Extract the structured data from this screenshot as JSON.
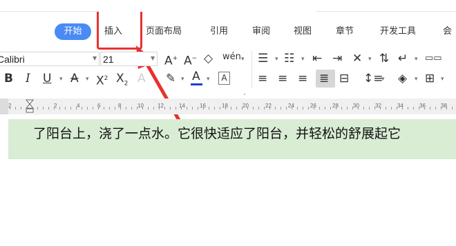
{
  "tabs": {
    "start": "开始",
    "insert": "插入",
    "layout": "页面布局",
    "references": "引用",
    "review": "审阅",
    "view": "视图",
    "section": "章节",
    "developer": "开发工具",
    "more": "会"
  },
  "font": {
    "name": "Calibri",
    "size": "21"
  },
  "ruler_numbers": [
    "2",
    "2",
    "4",
    "6",
    "8",
    "10",
    "12",
    "14",
    "16",
    "18",
    "20",
    "22",
    "24",
    "26",
    "28",
    "30",
    "32",
    "34",
    "36",
    "38"
  ],
  "document": {
    "text": "了阳台上，浇了一点水。它很快适应了阳台，并轻松的舒展起它"
  },
  "colors": {
    "accent": "#4a8af4",
    "highlight": "#e8312f",
    "doc_band": "#d9ecd4"
  }
}
